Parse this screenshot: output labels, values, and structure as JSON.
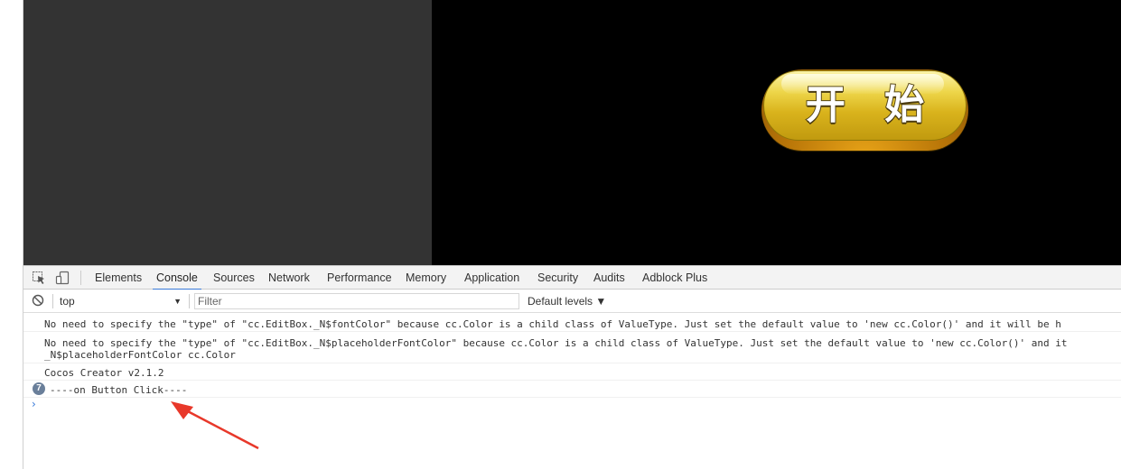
{
  "game": {
    "start_button_label": "开 始"
  },
  "devtools": {
    "tool_icons": [
      "inspect-element-icon",
      "device-toolbar-icon"
    ],
    "tabs": [
      "Elements",
      "Console",
      "Sources",
      "Network",
      "Performance",
      "Memory",
      "Application",
      "Security",
      "Audits",
      "Adblock Plus"
    ],
    "active_tab": "Console",
    "toolbar": {
      "clear_icon": "clear-console-icon",
      "context": "top",
      "filter_placeholder": "Filter",
      "levels": "Default levels ▼"
    },
    "messages": [
      {
        "text": "No need to specify the \"type\" of \"cc.EditBox._N$fontColor\" because cc.Color is a child class of ValueType. Just set the default value to 'new cc.Color()' and it will be h"
      },
      {
        "text": "No need to specify the \"type\" of \"cc.EditBox._N$placeholderFontColor\" because cc.Color is a child class of ValueType. Just set the default value to 'new cc.Color()' and it",
        "text2": "_N$placeholderFontColor cc.Color"
      },
      {
        "text": "Cocos Creator v2.1.2"
      },
      {
        "text": "----on Button Click----",
        "repeat_count": "7"
      }
    ]
  },
  "colors": {
    "accent": "#3879d9",
    "annotation_arrow": "#e8382a"
  }
}
